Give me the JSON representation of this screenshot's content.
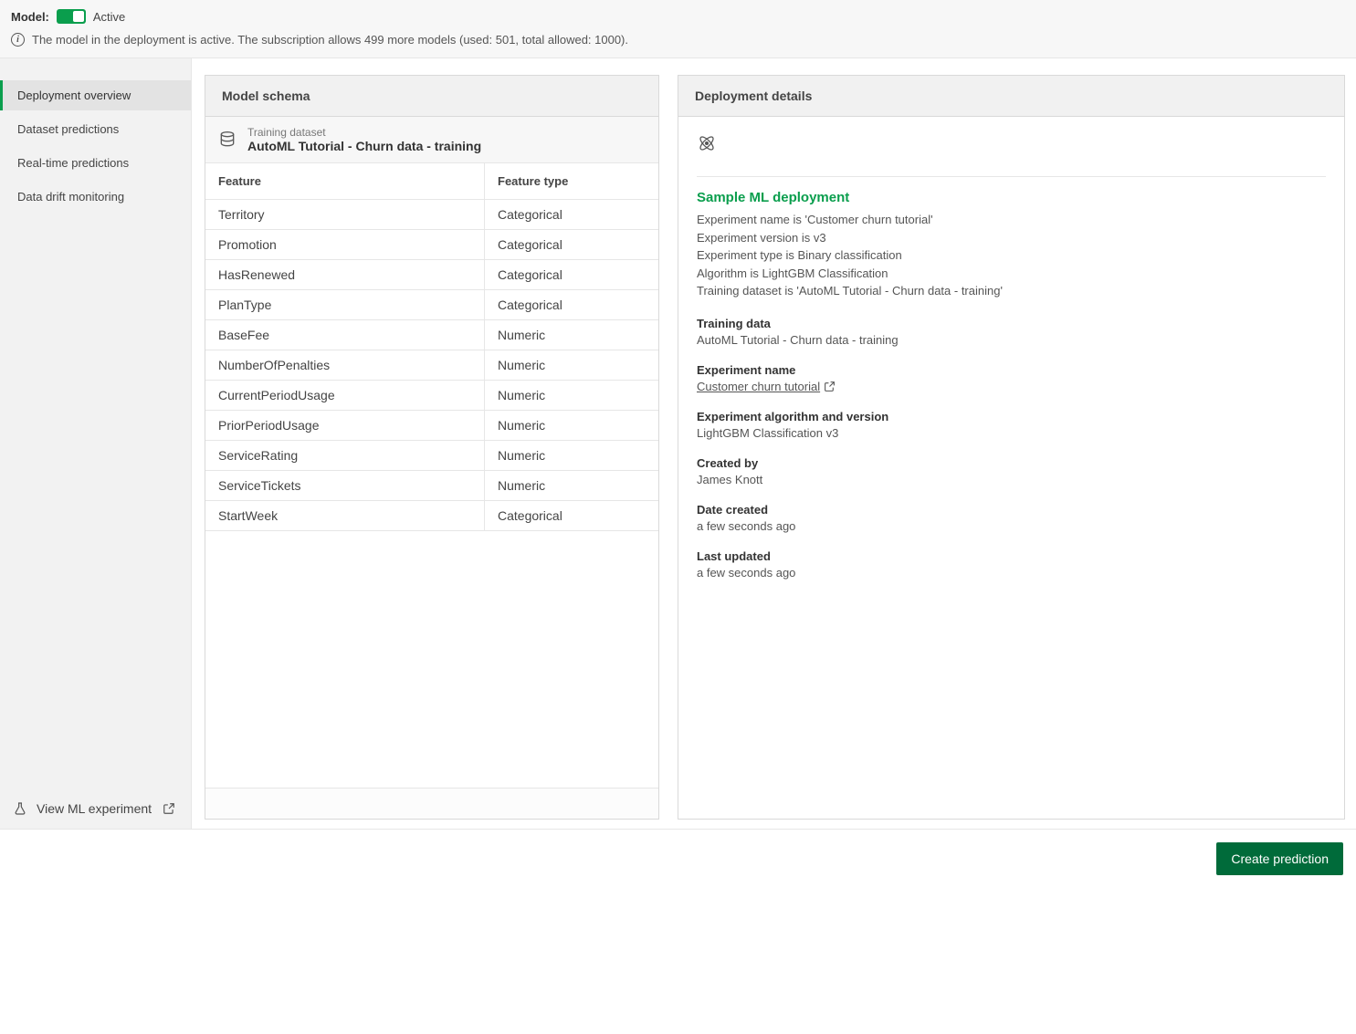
{
  "banner": {
    "label": "Model:",
    "toggle_status": "Active",
    "info_text": "The model in the deployment is active. The subscription allows 499 more models (used: 501, total allowed: 1000)."
  },
  "sidebar": {
    "items": [
      {
        "label": "Deployment overview",
        "active": true
      },
      {
        "label": "Dataset predictions",
        "active": false
      },
      {
        "label": "Real-time predictions",
        "active": false
      },
      {
        "label": "Data drift monitoring",
        "active": false
      }
    ],
    "bottom_link": "View ML experiment"
  },
  "schema": {
    "panel_title": "Model schema",
    "training_label": "Training dataset",
    "training_name": "AutoML Tutorial - Churn data - training",
    "col_feature": "Feature",
    "col_type": "Feature type",
    "rows": [
      {
        "feature": "Territory",
        "type": "Categorical"
      },
      {
        "feature": "Promotion",
        "type": "Categorical"
      },
      {
        "feature": "HasRenewed",
        "type": "Categorical"
      },
      {
        "feature": "PlanType",
        "type": "Categorical"
      },
      {
        "feature": "BaseFee",
        "type": "Numeric"
      },
      {
        "feature": "NumberOfPenalties",
        "type": "Numeric"
      },
      {
        "feature": "CurrentPeriodUsage",
        "type": "Numeric"
      },
      {
        "feature": "PriorPeriodUsage",
        "type": "Numeric"
      },
      {
        "feature": "ServiceRating",
        "type": "Numeric"
      },
      {
        "feature": "ServiceTickets",
        "type": "Numeric"
      },
      {
        "feature": "StartWeek",
        "type": "Categorical"
      }
    ]
  },
  "details": {
    "panel_title": "Deployment details",
    "name": "Sample ML deployment",
    "summary_lines": [
      "Experiment name is 'Customer churn tutorial'",
      "Experiment version is v3",
      "Experiment type is Binary classification",
      "Algorithm is LightGBM Classification",
      "Training dataset is 'AutoML Tutorial - Churn data - training'"
    ],
    "blocks": [
      {
        "label": "Training data",
        "value": "AutoML Tutorial - Churn data - training",
        "link": false
      },
      {
        "label": "Experiment name",
        "value": "Customer churn tutorial",
        "link": true
      },
      {
        "label": "Experiment algorithm and version",
        "value": "LightGBM Classification v3",
        "link": false
      },
      {
        "label": "Created by",
        "value": "James Knott",
        "link": false
      },
      {
        "label": "Date created",
        "value": "a few seconds ago",
        "link": false
      },
      {
        "label": "Last updated",
        "value": "a few seconds ago",
        "link": false
      }
    ]
  },
  "actions": {
    "create_prediction": "Create prediction"
  }
}
